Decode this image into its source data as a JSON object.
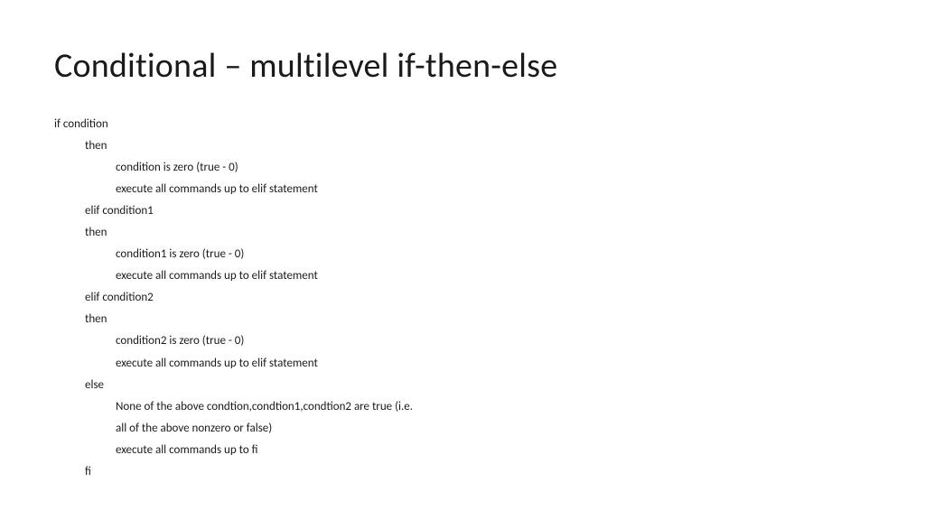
{
  "title": "Conditional – multilevel if-then-else",
  "lines": [
    {
      "indent": 0,
      "text": "if condition"
    },
    {
      "indent": 1,
      "text": "then"
    },
    {
      "indent": 2,
      "text": "condition is zero (true - 0)"
    },
    {
      "indent": 2,
      "text": "execute all commands up to elif statement"
    },
    {
      "indent": 1,
      "text": "elif condition1"
    },
    {
      "indent": 1,
      "text": "then"
    },
    {
      "indent": 2,
      "text": "condition1 is zero (true - 0)"
    },
    {
      "indent": 2,
      "text": "execute all commands up to elif statement"
    },
    {
      "indent": 1,
      "text": "elif condition2"
    },
    {
      "indent": 1,
      "text": "then"
    },
    {
      "indent": 2,
      "text": "condition2 is zero (true - 0)"
    },
    {
      "indent": 2,
      "text": "execute all commands up to elif statement"
    },
    {
      "indent": 1,
      "text": "else"
    },
    {
      "indent": 2,
      "text": "None of the above condtion,condtion1,condtion2 are true (i.e."
    },
    {
      "indent": 2,
      "text": "all of the above nonzero or false)"
    },
    {
      "indent": 2,
      "text": "execute all commands up to fi"
    },
    {
      "indent": 1,
      "text": "fi"
    }
  ]
}
